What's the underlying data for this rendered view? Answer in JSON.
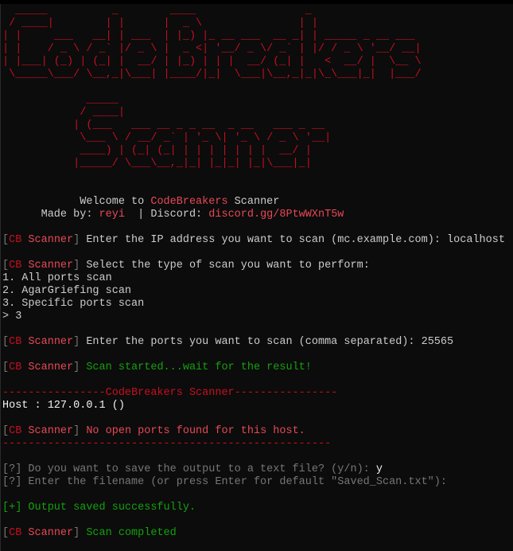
{
  "colors": {
    "background": "#0c0c0c",
    "text": "#cccccc",
    "red": "#e74856",
    "dark_red": "#c50f1f",
    "gray": "#767676",
    "green": "#13a10e"
  },
  "banner": {
    "codebreakers": [
      "  _____          _        ____                 _                 ",
      " / ____|        | |      |  _ \\               | |                ",
      "| |     ___   __| | ___  | |_) |_ __ ___  __ _| | _____ _ __ ___ ",
      "| |    / _ \\ / _` |/ _ \\ |  _ <| '__/ _ \\/ _` | |/ / _ \\ '__/ __|",
      "| |___| (_) | (_| |  __/ | |_) | | |  __/ (_| |   <  __/ |  \\__ \\",
      " \\_____\\___/ \\__,_|\\___| |____/|_|  \\___|\\__,_|_|\\_\\___|_|  |___/"
    ],
    "scanner": [
      "             _____                                 ",
      "            / ____|                                ",
      "           | (___   ___ __ _ _ __  _ __   ___ _ __ ",
      "            \\___ \\ / __/ _` | '_ \\| '_ \\ / _ \\ '__|",
      "            ____) | (_| (_| | | | | | | |  __/ |   ",
      "           |_____/ \\___\\__,_|_| |_|_| |_|\\___|_|   "
    ]
  },
  "welcome": {
    "prefix": "            Welcome to ",
    "brand": "CodeBreakers",
    "suffix": " Scanner"
  },
  "credits": {
    "made_by_label": "      Made by: ",
    "author": "reyi",
    "discord_label": "  | Discord: ",
    "discord_link": "discord.gg/8PtwWXnT5w"
  },
  "prompt_tag": {
    "open": "[",
    "cb": "CB",
    "name": " Scanner",
    "close": "]"
  },
  "lines": {
    "ip_prompt": " Enter the IP address you want to scan (mc.example.com): ",
    "ip_value": "localhost",
    "scan_type_prompt": " Select the type of scan you want to perform:",
    "options": [
      "1. All ports scan",
      "2. AgarGriefing scan",
      "3. Specific ports scan"
    ],
    "choice": "> 3",
    "ports_prompt": " Enter the ports you want to scan (comma separated): ",
    "ports_value": "25565",
    "scan_started": " Scan started...wait for the result!",
    "result_header": "----------------CodeBreakers Scanner----------------",
    "host": "Host : 127.0.0.1 ()",
    "no_ports": " No open ports found for this host.",
    "result_footer": "---------------------------------------------------",
    "save_prompt": "[?] Do you want to save the output to a text file? (y/n): ",
    "save_value": "y",
    "filename_prompt": "[?] Enter the filename (or press Enter for default \"Saved_Scan.txt\"):",
    "saved": "[+] Output saved successfully.",
    "completed": " Scan completed"
  }
}
